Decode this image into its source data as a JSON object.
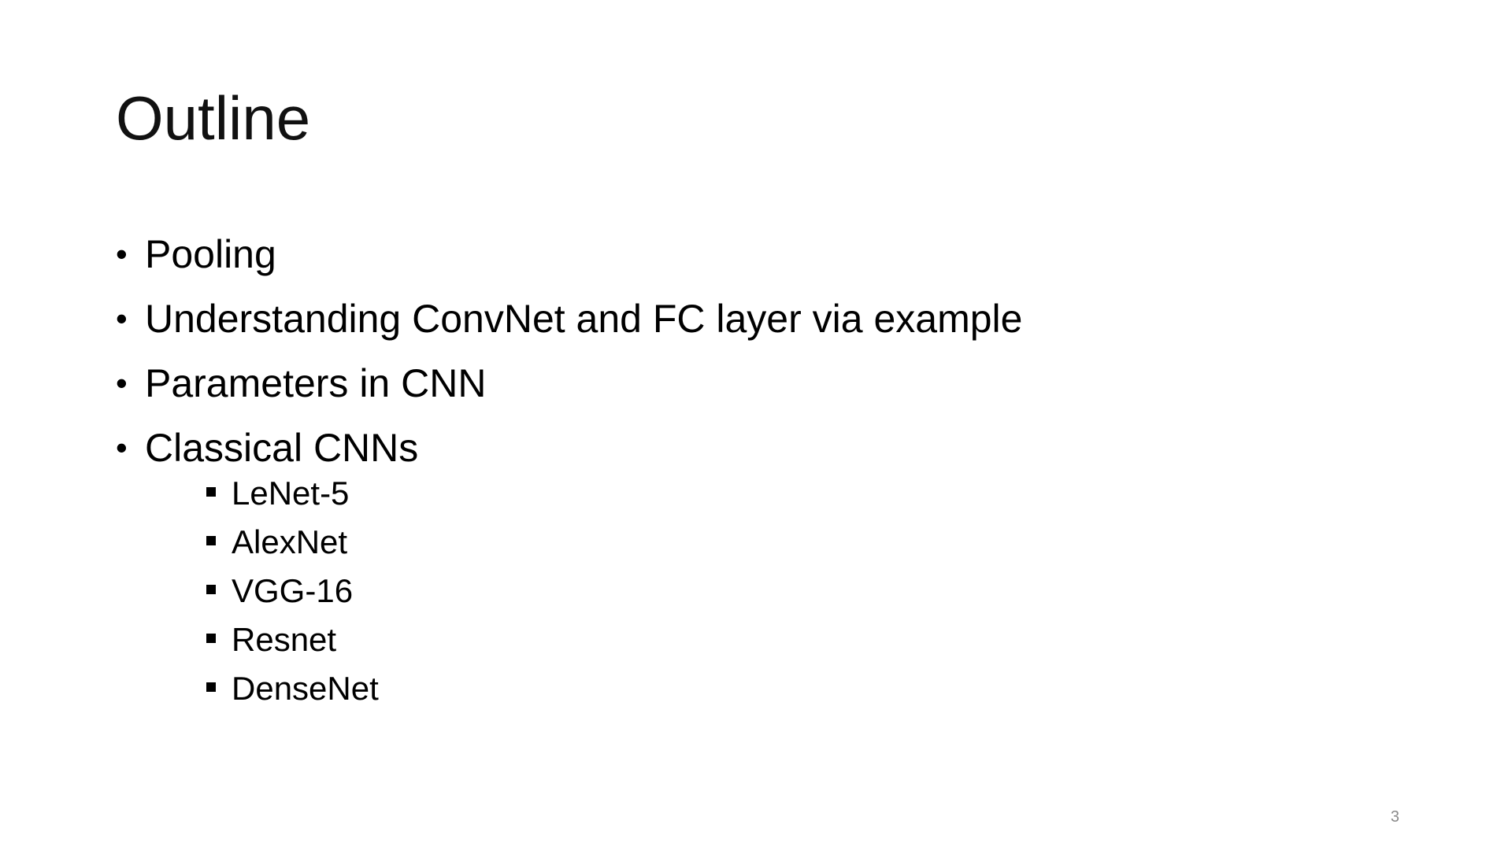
{
  "slide": {
    "title": "Outline",
    "bullets": [
      {
        "text": "Pooling"
      },
      {
        "text": "Understanding ConvNet and FC layer via example"
      },
      {
        "text": "Parameters in CNN"
      },
      {
        "text": "Classical CNNs",
        "subitems": [
          "LeNet-5",
          "AlexNet",
          "VGG-16",
          "Resnet",
          "DenseNet"
        ]
      }
    ],
    "page_number": "3"
  }
}
